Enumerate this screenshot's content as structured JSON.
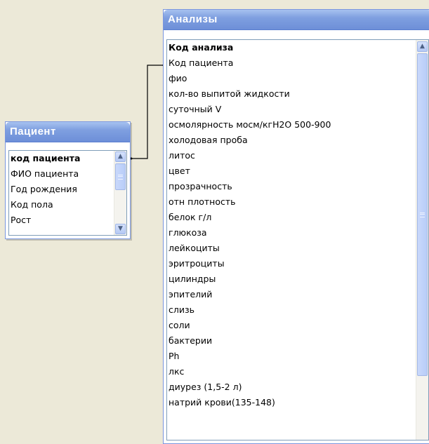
{
  "patient_table": {
    "title": "Пациент",
    "fields": [
      "код пациента",
      "ФИО пациента",
      "Год рождения",
      "Код пола",
      "Рост"
    ]
  },
  "analyses_table": {
    "title": "Анализы",
    "fields": [
      "Код анализа",
      "Код пациента",
      "фио",
      "кол-во выпитой жидкости",
      "суточный V",
      "осмолярность мосм/кгН2О 500-900",
      "холодовая проба",
      "литос",
      "цвет",
      "прозрачность",
      "отн плотность",
      "белок г/л",
      "глюкоза",
      "лейкоциты",
      "эритроциты",
      "цилиндры",
      "эпителий",
      "слизь",
      "соли",
      "бактерии",
      "Ph",
      "лкс",
      "диурез (1,5-2 л)",
      "натрий крови(135-148)"
    ]
  },
  "relationship": {
    "from": "код пациента",
    "to": "Код пациента"
  }
}
